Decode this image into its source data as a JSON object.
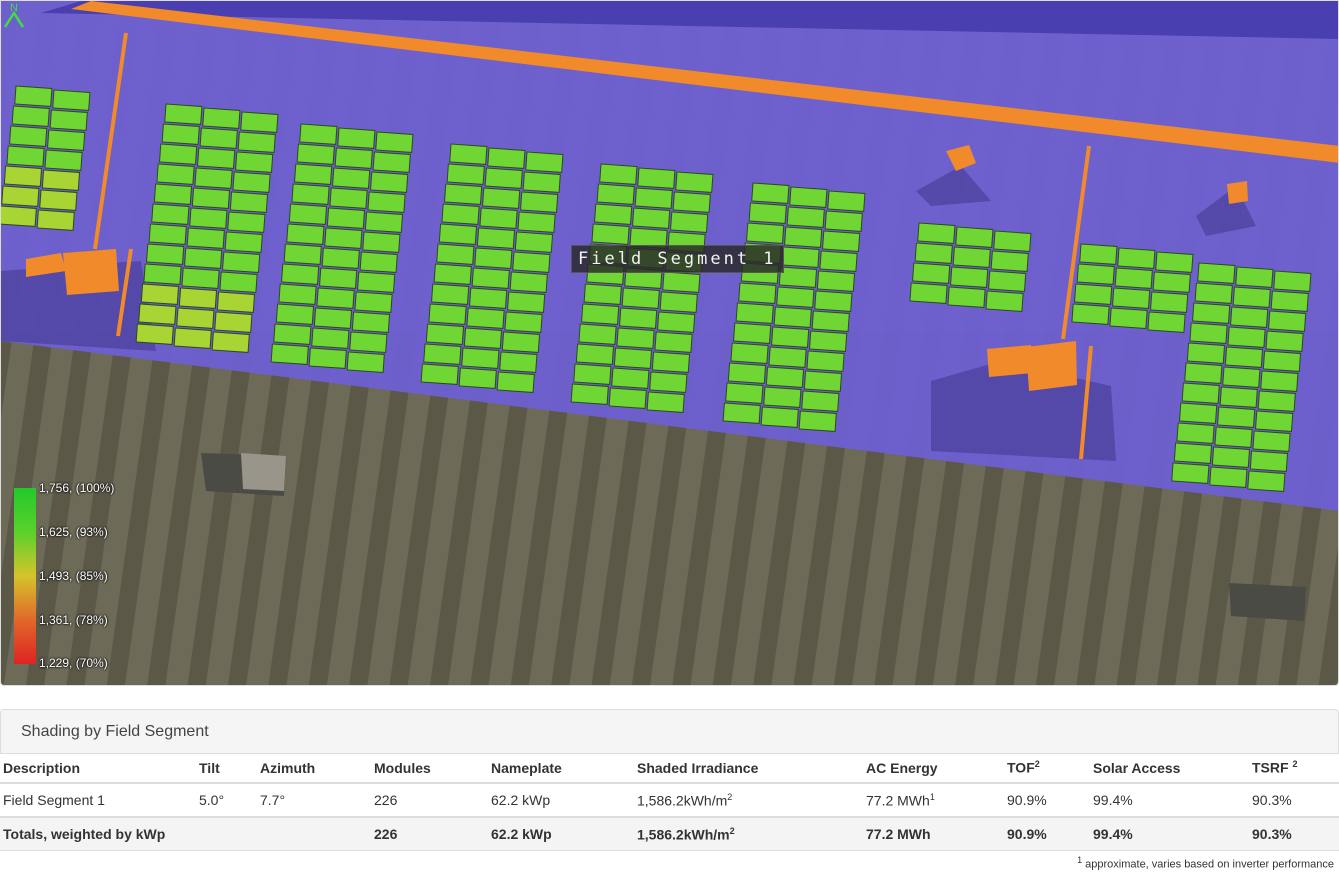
{
  "map": {
    "segment_label": "Field Segment 1",
    "legend": [
      {
        "label": "1,756, (100%)"
      },
      {
        "label": "1,625, (93%)"
      },
      {
        "label": "1,493, (85%)"
      },
      {
        "label": "1,361, (78%)"
      },
      {
        "label": "1,229, (70%)"
      }
    ],
    "north_symbol": "N",
    "colors": {
      "roof": "#6e5fd6",
      "obstruction": "#f08a2a",
      "module": "#6fd634"
    }
  },
  "section": {
    "title": "Shading by Field Segment"
  },
  "table": {
    "headers": {
      "description": "Description",
      "tilt": "Tilt",
      "azimuth": "Azimuth",
      "modules": "Modules",
      "nameplate": "Nameplate",
      "shaded_irradiance": "Shaded Irradiance",
      "ac_energy": "AC Energy",
      "tof": "TOF",
      "tof_sup": "2",
      "solar_access": "Solar Access",
      "tsrf": "TSRF ",
      "tsrf_sup": "2"
    },
    "row": {
      "description": "Field Segment 1",
      "tilt": "5.0°",
      "azimuth": "7.7°",
      "modules": "226",
      "nameplate": "62.2 kWp",
      "shaded_irradiance": "1,586.2kWh/m",
      "irr_sup": "2",
      "ac_energy": "77.2 MWh",
      "ac_sup": "1",
      "tof": "90.9%",
      "solar_access": "99.4%",
      "tsrf": "90.3%"
    },
    "totals": {
      "description": "Totals, weighted by kWp",
      "modules": "226",
      "nameplate": "62.2 kWp",
      "shaded_irradiance": "1,586.2kWh/m",
      "irr_sup": "2",
      "ac_energy": "77.2 MWh",
      "tof": "90.9%",
      "solar_access": "99.4%",
      "tsrf": "90.3%"
    }
  },
  "footnote": {
    "marker": "1",
    "text": " approximate, varies based on inverter performance"
  }
}
